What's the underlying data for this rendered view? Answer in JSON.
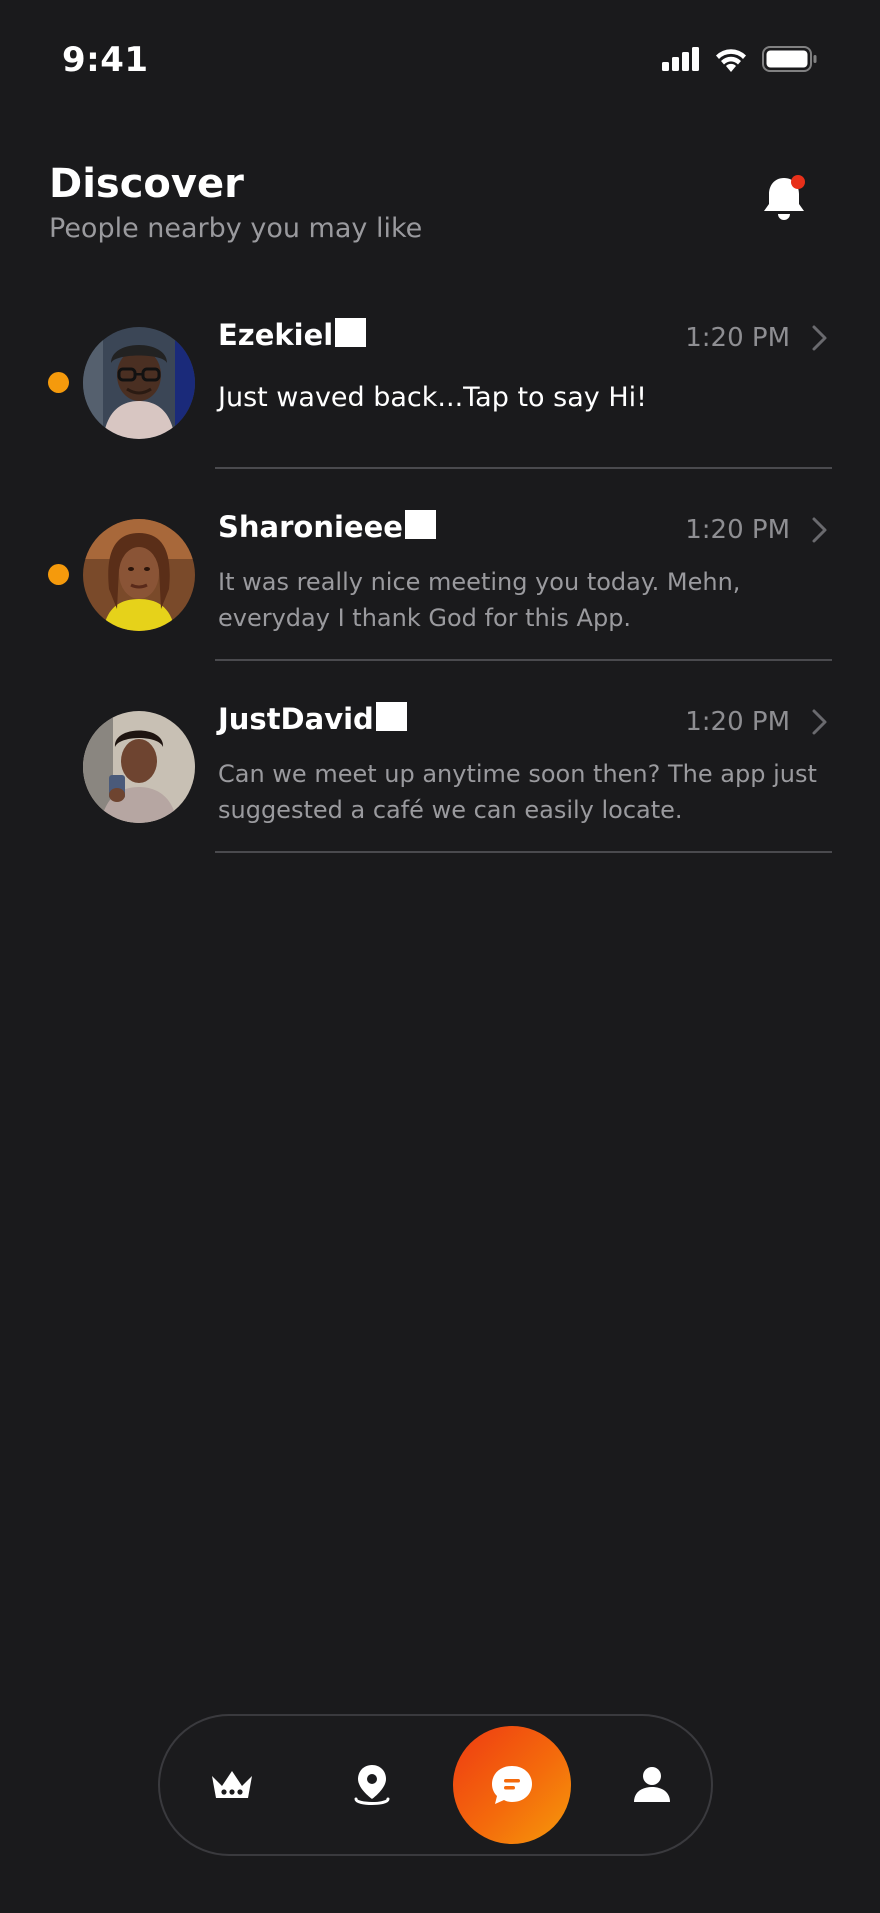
{
  "status_bar": {
    "time": "9:41",
    "icons": [
      "cellular-signal-icon",
      "wifi-icon",
      "battery-icon"
    ]
  },
  "header": {
    "title": "Discover",
    "subtitle": "People nearby you may like",
    "notification_icon": "bell-icon",
    "has_notification_badge": true
  },
  "chats": [
    {
      "name": "Ezekiel",
      "time": "1:20 PM",
      "message": "Just waved back...Tap to say Hi!",
      "unread": true
    },
    {
      "name": "Sharonieee",
      "time": "1:20 PM",
      "message": "It was really nice meeting you today. Mehn, everyday I thank God for this App.",
      "unread": true
    },
    {
      "name": "JustDavid",
      "time": "1:20 PM",
      "message": "Can we meet up anytime soon then? The app just suggested a café we can easily locate.",
      "unread": false
    }
  ],
  "bottom_nav": {
    "items": [
      "crown-icon",
      "location-pin-icon",
      "chat-bubble-icon",
      "profile-icon"
    ],
    "active": "chat-bubble-icon"
  },
  "colors": {
    "background": "#1a1a1c",
    "accent": "#f46a0c",
    "unread_dot": "#f59a0c",
    "notification_badge": "#e8301a",
    "muted_text": "#9a9a9e"
  }
}
